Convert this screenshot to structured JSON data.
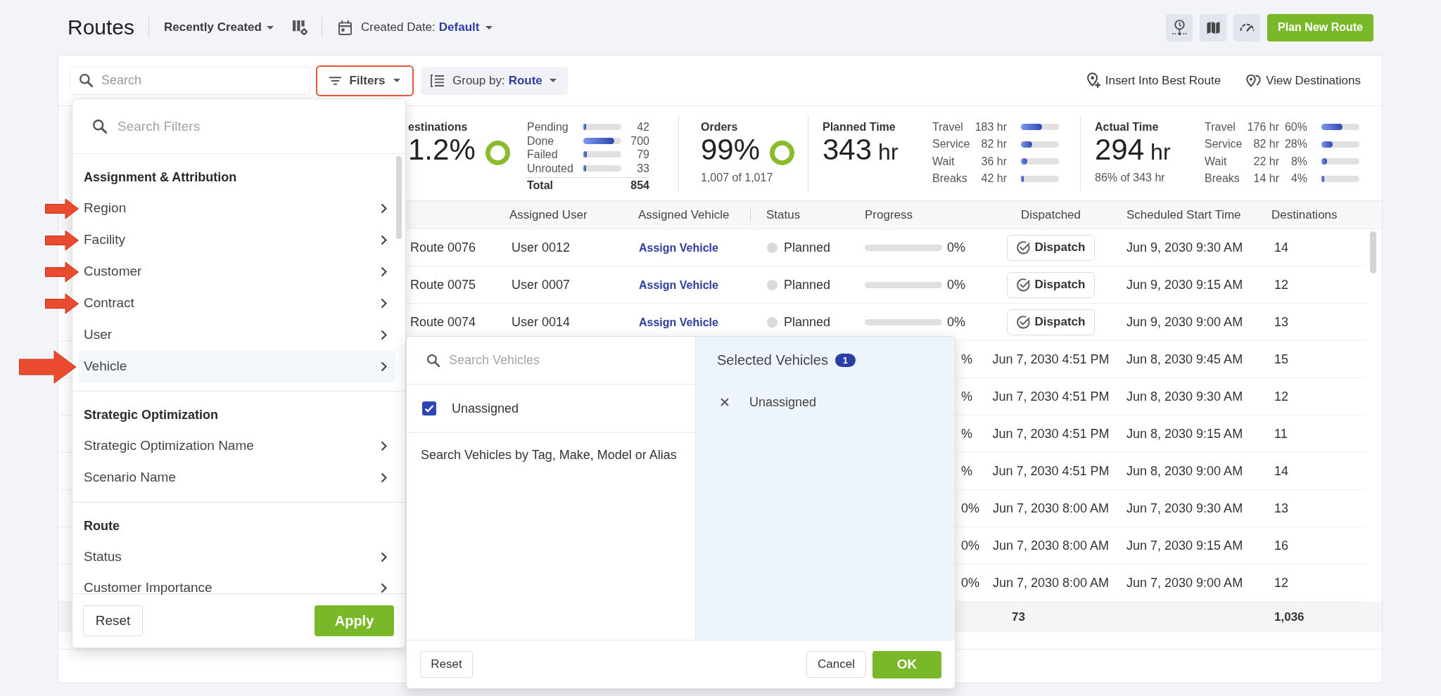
{
  "header": {
    "title": "Routes",
    "sort": {
      "label": "Recently Created"
    },
    "date_filter": {
      "label": "Created Date:",
      "value": "Default"
    },
    "primary_button": "Plan New Route"
  },
  "toolbar": {
    "search": {
      "placeholder": "Search"
    },
    "filters": {
      "label": "Filters",
      "outlined": true
    },
    "group_by": {
      "label": "Group by:",
      "value": "Route"
    },
    "actions": [
      {
        "kind": "insert",
        "label": "Insert Into Best Route"
      },
      {
        "kind": "destinations",
        "label": "View Destinations"
      }
    ]
  },
  "stats": [
    {
      "kind": "counts",
      "title": "estinations",
      "value": "1.2%",
      "donut": true,
      "rows": [
        {
          "label": "Pending",
          "value": "42",
          "level": 0.05
        },
        {
          "label": "Done",
          "value": "700",
          "level": 0.82
        },
        {
          "label": "Failed",
          "value": "79",
          "level": 0.09
        },
        {
          "label": "Unrouted",
          "value": "33",
          "level": 0.04
        }
      ],
      "total": {
        "label": "Total",
        "value": "854"
      }
    },
    {
      "kind": "percent",
      "title": "Orders",
      "value": "99%",
      "donut": true,
      "subtitle": "1,007 of 1,017"
    },
    {
      "kind": "time",
      "title": "Planned Time",
      "value": "343",
      "unit": "hr",
      "donut": false,
      "rows": [
        {
          "label": "Travel",
          "value": "183 hr",
          "level": 0.55
        },
        {
          "label": "Service",
          "value": "82 hr",
          "level": 0.3
        },
        {
          "label": "Wait",
          "value": "36 hr",
          "level": 0.17
        },
        {
          "label": "Breaks",
          "value": "42 hr",
          "level": 0.08
        }
      ]
    },
    {
      "kind": "time",
      "title": "Actual Time",
      "value": "294",
      "unit": "hr",
      "donut": false,
      "subtitle": "86% of 343 hr",
      "rows": [
        {
          "label": "Travel",
          "value": "176 hr",
          "percent": "60%",
          "level": 0.55
        },
        {
          "label": "Service",
          "value": "82 hr",
          "percent": "28%",
          "level": 0.3
        },
        {
          "label": "Wait",
          "value": "22 hr",
          "percent": "8%",
          "level": 0.15
        },
        {
          "label": "Breaks",
          "value": "14 hr",
          "percent": "4%",
          "level": 0.07
        }
      ]
    }
  ],
  "table": {
    "columns": [
      "Assigned User",
      "Assigned Vehicle",
      "Status",
      "Progress",
      "Dispatched",
      "Scheduled Start Time",
      "Destinations"
    ],
    "rows": [
      {
        "route": "Route 0076",
        "user": "User 0012",
        "vehicle": "Assign Vehicle",
        "status": {
          "label": "Planned",
          "color": "#d9d9d9"
        },
        "progress": {
          "level": 0,
          "label": "0%"
        },
        "dispatched": {
          "kind": "button",
          "label": "Dispatch"
        },
        "scheduled": "Jun 9, 2030 9:30 AM",
        "destinations": "14"
      },
      {
        "route": "Route 0075",
        "user": "User 0007",
        "vehicle": "Assign Vehicle",
        "status": {
          "label": "Planned",
          "color": "#d9d9d9"
        },
        "progress": {
          "level": 0,
          "label": "0%"
        },
        "dispatched": {
          "kind": "button",
          "label": "Dispatch"
        },
        "scheduled": "Jun 9, 2030 9:15 AM",
        "destinations": "12"
      },
      {
        "route": "Route 0074",
        "user": "User 0014",
        "vehicle": "Assign Vehicle",
        "status": {
          "label": "Planned",
          "color": "#d9d9d9"
        },
        "progress": {
          "level": 0,
          "label": "0%"
        },
        "dispatched": {
          "kind": "button",
          "label": "Dispatch"
        },
        "scheduled": "Jun 9, 2030 9:00 AM",
        "destinations": "13"
      },
      {
        "progress": {
          "label": "%"
        },
        "dispatched": {
          "kind": "date",
          "label": "Jun 7, 2030 4:51 PM"
        },
        "scheduled": "Jun 8, 2030 9:45 AM",
        "destinations": "15"
      },
      {
        "progress": {
          "label": "%"
        },
        "dispatched": {
          "kind": "date",
          "label": "Jun 7, 2030 4:51 PM"
        },
        "scheduled": "Jun 8, 2030 9:30 AM",
        "destinations": "12"
      },
      {
        "progress": {
          "label": "%"
        },
        "dispatched": {
          "kind": "date",
          "label": "Jun 7, 2030 4:51 PM"
        },
        "scheduled": "Jun 8, 2030 9:15 AM",
        "destinations": "11"
      },
      {
        "progress": {
          "label": "%"
        },
        "dispatched": {
          "kind": "date",
          "label": "Jun 7, 2030 4:51 PM"
        },
        "scheduled": "Jun 8, 2030 9:00 AM",
        "destinations": "14"
      },
      {
        "progress": {
          "label": "0%"
        },
        "dispatched": {
          "kind": "date",
          "label": "Jun 7, 2030 8:00 AM"
        },
        "scheduled": "Jun 7, 2030 9:30 AM",
        "destinations": "13"
      },
      {
        "progress": {
          "label": "0%"
        },
        "dispatched": {
          "kind": "date",
          "label": "Jun 7, 2030 8:00 AM"
        },
        "scheduled": "Jun 7, 2030 9:15 AM",
        "destinations": "16"
      },
      {
        "progress": {
          "label": "0%"
        },
        "dispatched": {
          "kind": "date",
          "label": "Jun 7, 2030 8:00 AM"
        },
        "scheduled": "Jun 7, 2030 9:00 AM",
        "destinations": "12"
      }
    ],
    "totals": {
      "dispatched": "73",
      "destinations": "1,036"
    }
  },
  "filter_panel": {
    "search": {
      "placeholder": "Search Filters"
    },
    "sections": [
      {
        "title": "Assignment & Attribution",
        "items": [
          {
            "label": "Region",
            "selected": false,
            "arrow": true
          },
          {
            "label": "Facility",
            "selected": false,
            "arrow": true
          },
          {
            "label": "Customer",
            "selected": false,
            "arrow": true
          },
          {
            "label": "Contract",
            "selected": false,
            "arrow": true
          },
          {
            "label": "User",
            "selected": false,
            "arrow": false
          },
          {
            "label": "Vehicle",
            "selected": true,
            "arrow": true
          }
        ]
      },
      {
        "title": "Strategic Optimization",
        "items": [
          {
            "label": "Strategic Optimization Name",
            "selected": false,
            "arrow": false
          },
          {
            "label": "Scenario Name",
            "selected": false,
            "arrow": false
          }
        ]
      },
      {
        "title": "Route",
        "items": [
          {
            "label": "Status",
            "selected": false,
            "arrow": false
          },
          {
            "label": "Customer Importance",
            "selected": false,
            "arrow": false
          }
        ]
      }
    ],
    "buttons": [
      {
        "label": "Reset",
        "kind": "secondary"
      },
      {
        "label": "Apply",
        "kind": "primary"
      }
    ]
  },
  "vehicle_picker": {
    "search": {
      "placeholder": "Search Vehicles"
    },
    "options": [
      {
        "label": "Unassigned",
        "checked": true
      }
    ],
    "hint": "Search Vehicles by Tag, Make, Model or Alias",
    "selected_title": "Selected Vehicles",
    "selected_count": "1",
    "selected": [
      {
        "label": "Unassigned"
      }
    ],
    "buttons": [
      {
        "label": "Reset",
        "kind": "secondary"
      },
      {
        "label": "Cancel",
        "kind": "secondary"
      },
      {
        "label": "OK",
        "kind": "primary"
      }
    ]
  }
}
